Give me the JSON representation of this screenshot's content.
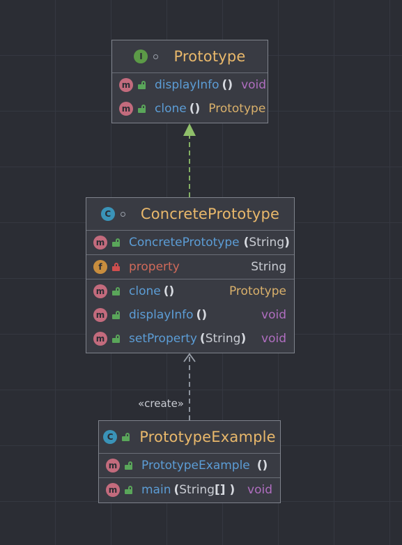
{
  "diagram": {
    "prototype": {
      "badge": "I",
      "title": "Prototype",
      "methods": [
        {
          "badge": "m",
          "name": "displayInfo",
          "params": "()",
          "ret": "void"
        },
        {
          "badge": "m",
          "name": "clone",
          "params": "()",
          "ret": "Prototype"
        }
      ]
    },
    "concrete": {
      "badge": "C",
      "title": "ConcretePrototype",
      "constructor": {
        "badge": "m",
        "name": "ConcretePrototype",
        "params_open": "(",
        "params_type": "String",
        "params_close": ")"
      },
      "field": {
        "badge": "f",
        "name": "property",
        "type": "String"
      },
      "methods": [
        {
          "badge": "m",
          "name": "clone",
          "params": "()",
          "ret": "Prototype"
        },
        {
          "badge": "m",
          "name": "displayInfo",
          "params": "()",
          "ret": "void"
        },
        {
          "badge": "m",
          "name": "setProperty",
          "params_open": "(",
          "params_type": "String",
          "params_close": ")",
          "ret": "void"
        }
      ]
    },
    "example": {
      "badge": "C",
      "title": "PrototypeExample",
      "constructor": {
        "badge": "m",
        "name": "PrototypeExample",
        "params": "()"
      },
      "main": {
        "badge": "m",
        "name": "main",
        "params_open": "(",
        "params_type": "String",
        "params_close": " [] )",
        "ret": "void"
      }
    },
    "edge_label": "«create»"
  },
  "colors": {
    "background": "#2b2d34",
    "box": "#393b43",
    "title": "#e9b86b",
    "method_name": "#5c9dd6",
    "field_name": "#d06a5a",
    "void_type": "#b06ec0",
    "realization_arrow": "#8fbf6a"
  }
}
